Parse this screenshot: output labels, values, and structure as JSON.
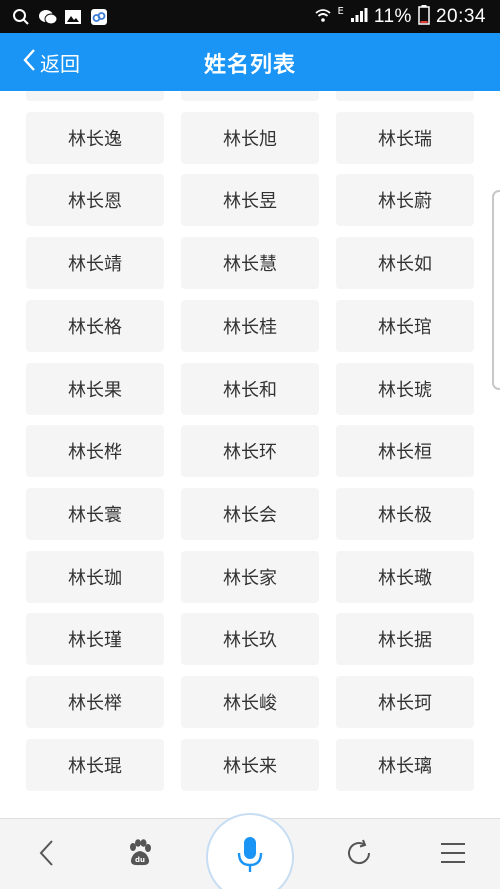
{
  "status_bar": {
    "network": "E",
    "battery_text": "11%",
    "time": "20:34",
    "left_icons": [
      "search-icon",
      "wechat-icon",
      "gallery-icon",
      "app-icon"
    ]
  },
  "header": {
    "back_label": "返回",
    "title": "姓名列表",
    "background": "#1a94f5"
  },
  "names": [
    "",
    "",
    "",
    "林长逸",
    "林长旭",
    "林长瑞",
    "林长恩",
    "林长昱",
    "林长蔚",
    "林长靖",
    "林长慧",
    "林长如",
    "林长格",
    "林长桂",
    "林长琯",
    "林长果",
    "林长和",
    "林长琥",
    "林长桦",
    "林长环",
    "林长桓",
    "林长寰",
    "林长会",
    "林长极",
    "林长珈",
    "林长家",
    "林长璥",
    "林长瑾",
    "林长玖",
    "林长据",
    "林长榉",
    "林长峻",
    "林长珂",
    "林长琨",
    "林长来",
    "林长璃"
  ],
  "bottom_bar": {
    "items": [
      "back-icon",
      "baidu-paw-icon",
      "microphone-icon",
      "refresh-icon",
      "menu-icon"
    ],
    "mic_color": "#1a94f5"
  }
}
